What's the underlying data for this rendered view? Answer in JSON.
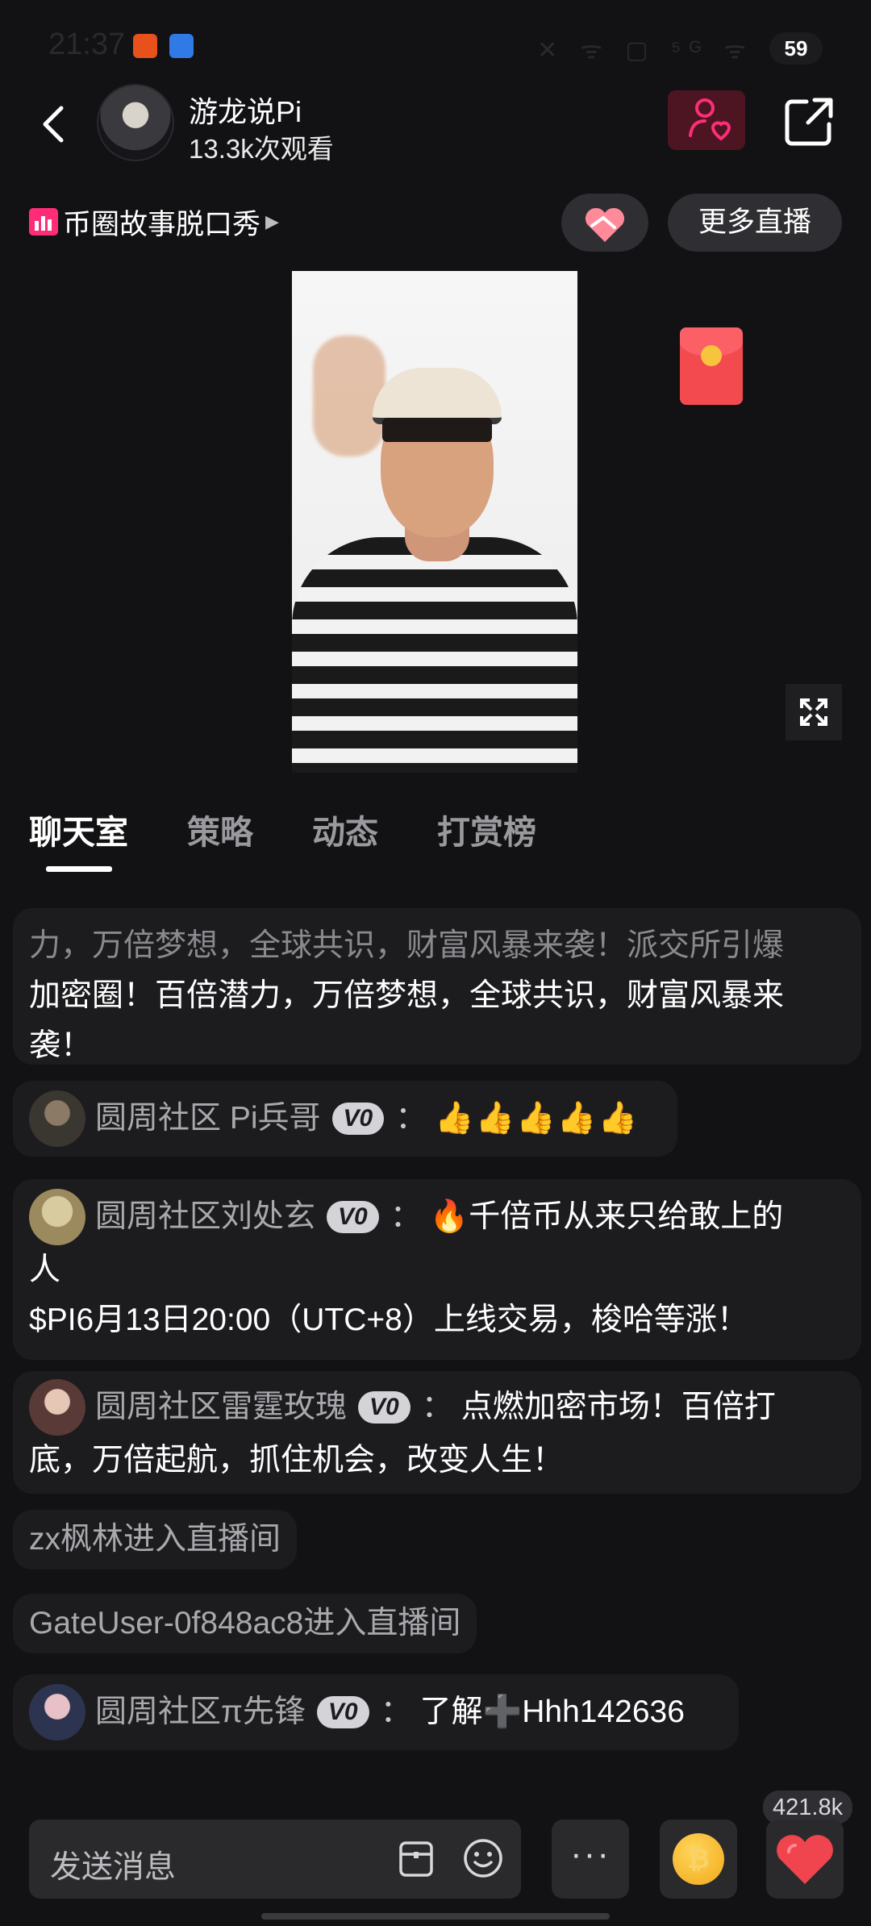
{
  "status_bar": {
    "time": "21:37",
    "icons": "✕ ᯤ ▢ ⁵ᴳ ᯤ",
    "battery": "59"
  },
  "header": {
    "host_name": "游龙说Pi",
    "views": "13.3k次观看"
  },
  "subheader": {
    "live_tag": "币圈故事脱口秀",
    "tag_arrow": "▶",
    "more_live": "更多直播"
  },
  "tabs": [
    {
      "label": "聊天室"
    },
    {
      "label": "策略"
    },
    {
      "label": "动态"
    },
    {
      "label": "打赏榜"
    }
  ],
  "chat": {
    "faded_line": "力，万倍梦想，全球共识，财富风暴来袭！派交所引爆",
    "msg0_line1": "加密圈！百倍潜力，万倍梦想，全球共识，财富风暴来",
    "msg0_line2": "袭！",
    "msg1": {
      "user": "圆周社区 Pi兵哥",
      "badge": "V0",
      "colon": "：",
      "text": "👍👍👍👍👍"
    },
    "msg2": {
      "user": "圆周社区刘处玄",
      "badge": "V0",
      "colon": "：",
      "fire": "🔥",
      "text1": " 千倍币从来只给敢上的",
      "text2": "人",
      "text3": "$PI6月13日20:00（UTC+8）上线交易，梭哈等涨！"
    },
    "msg3": {
      "user": "圆周社区雷霆玫瑰",
      "badge": "V0",
      "colon": "：",
      "text1": "点燃加密市场！百倍打",
      "text2": "底，万倍起航，抓住机会，改变人生！"
    },
    "sys1": "zx枫林进入直播间",
    "sys2": "GateUser-0f848ac8进入直播间",
    "msg4": {
      "user": "圆周社区π先锋",
      "badge": "V0",
      "colon": "：",
      "text": "了解",
      "plus": "➕",
      "text_after": "Hhh142636"
    }
  },
  "bottom": {
    "like_count": "421.8k",
    "input_placeholder": "发送消息",
    "more_label": "···",
    "coin_symbol": "₿"
  },
  "colors": {
    "accent_pink": "#ff2d78",
    "red_envelope": "#f24a4f",
    "background": "#121214"
  }
}
